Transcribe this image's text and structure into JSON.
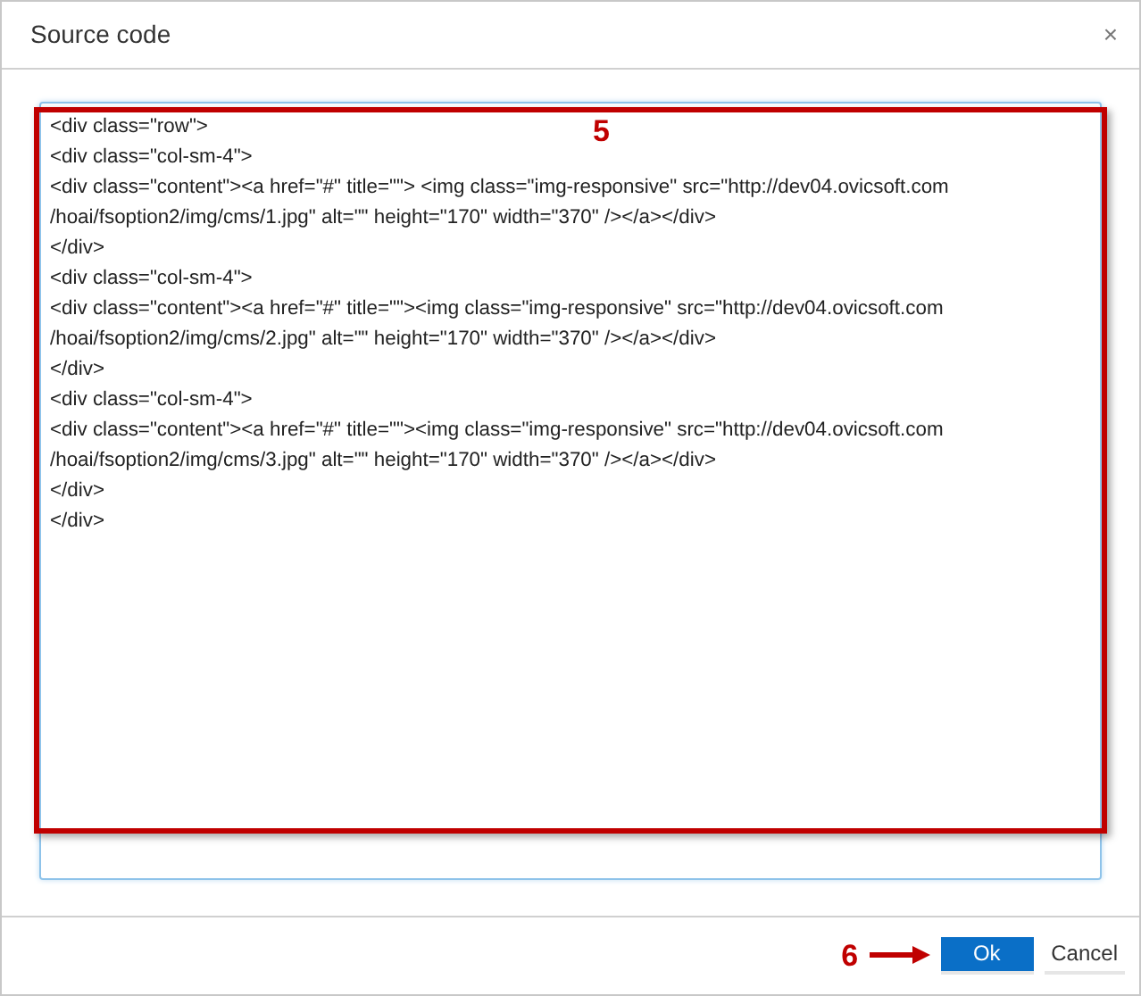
{
  "dialog": {
    "title": "Source code",
    "close": "×"
  },
  "editor": {
    "lines": [
      "<div class=\"row\">",
      "<div class=\"col-sm-4\">",
      "<div class=\"content\"><a href=\"#\" title=\"\"> <img class=\"img-responsive\" src=\"http://dev04.ovicsoft.com",
      "/hoai/fsoption2/img/cms/1.jpg\" alt=\"\" height=\"170\" width=\"370\" /></a></div>",
      "</div>",
      "<div class=\"col-sm-4\">",
      "<div class=\"content\"><a href=\"#\" title=\"\"><img class=\"img-responsive\" src=\"http://dev04.ovicsoft.com",
      "/hoai/fsoption2/img/cms/2.jpg\" alt=\"\" height=\"170\" width=\"370\" /></a></div>",
      "</div>",
      "<div class=\"col-sm-4\">",
      "<div class=\"content\"><a href=\"#\" title=\"\"><img class=\"img-responsive\" src=\"http://dev04.ovicsoft.com",
      "/hoai/fsoption2/img/cms/3.jpg\" alt=\"\" height=\"170\" width=\"370\" /></a></div>",
      "</div>",
      "</div>"
    ]
  },
  "annotations": [
    {
      "label": "5"
    },
    {
      "label": "6"
    }
  ],
  "buttons": [
    {
      "label": "Ok",
      "kind": "primary"
    },
    {
      "label": "Cancel",
      "kind": "plain"
    }
  ]
}
